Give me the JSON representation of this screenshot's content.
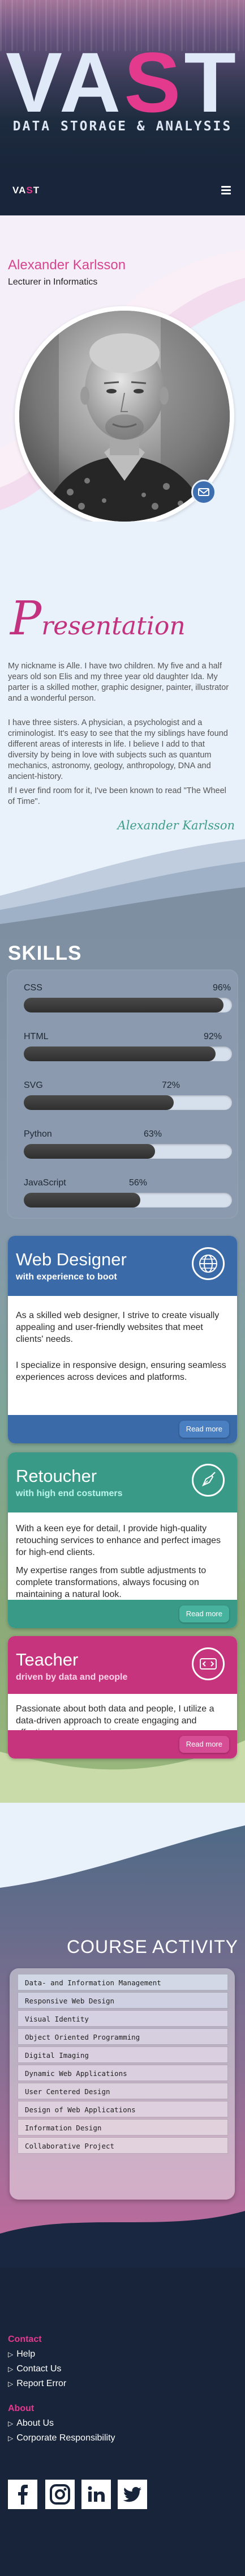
{
  "hero": {
    "brand": "VAST",
    "subtitle": "DATA STORAGE & ANALYSIS"
  },
  "navbar": {
    "logo": "VAST",
    "menu_icon": "hamburger-menu-icon"
  },
  "profile": {
    "name": "Alexander Karlsson",
    "role": "Lecturer in Informatics",
    "mail_icon": "envelope-icon"
  },
  "presentation": {
    "heading_initial": "P",
    "heading_rest": "resentation",
    "paragraphs": [
      "My nickname is Alle. I have two children. My five and a half years old son Elis and my three year old daughter Ida. My parter is a skilled mother, graphic designer, painter, illustrator and a wonderful person.",
      "I have three sisters. A physician, a psychologist and a criminologist. It's easy to see that the my siblings have found different areas of interests in life. I believe I add to that diversity by being in love with subjects such as quantum mechanics, astronomy, geology, anthropology, DNA and ancient-history.",
      "If I ever find room for it, I've been known to read \"The Wheel of Time\"."
    ],
    "signature": "Alexander Karlsson"
  },
  "skills": {
    "title": "SKILLS",
    "items": [
      {
        "label": "CSS",
        "pct_label": "96%",
        "level": 0.96
      },
      {
        "label": "HTML",
        "pct_label": "92%",
        "level": 0.92
      },
      {
        "label": "SVG",
        "pct_label": "72%",
        "level": 0.72
      },
      {
        "label": "Python",
        "pct_label": "63%",
        "level": 0.63
      },
      {
        "label": "JavaScript",
        "pct_label": "56%",
        "level": 0.56
      }
    ]
  },
  "cards": [
    {
      "title": "Web Designer",
      "subtitle": "with experience to boot",
      "icon": "globe-icon",
      "paragraphs": [
        "As a skilled web designer, I strive to create visually appealing and user-friendly websites that meet clients' needs.",
        "I specialize in responsive design, ensuring seamless experiences across devices and platforms."
      ],
      "button": "Read more",
      "head_color": "#3a6aa8",
      "sub_color": "#ffffff",
      "foot_color": "#3a6aa8",
      "btn_color": "#4a7fc2"
    },
    {
      "title": "Retoucher",
      "subtitle": "with high end costumers",
      "icon": "pen-nib-icon",
      "paragraphs": [
        "With a keen eye for detail, I provide high-quality retouching services to enhance and perfect images for high-end clients.",
        "My expertise ranges from subtle adjustments to complete transformations, always focusing on maintaining a natural look."
      ],
      "button": "Read more",
      "head_color": "#3a9a88",
      "sub_color": "#b9f5ea",
      "foot_color": "#3a9a88",
      "btn_color": "#47b39f"
    },
    {
      "title": "Teacher",
      "subtitle": "driven by data and people",
      "icon": "code-icon",
      "paragraphs": [
        "Passionate about both data and people, I utilize a data-driven approach to create engaging and effective learning experiences."
      ],
      "button": "Read more",
      "head_color": "#c5347c",
      "sub_color": "#ffd4ea",
      "foot_color": "#c5347c",
      "btn_color": "#d74d95"
    }
  ],
  "courses": {
    "title": "COURSE ACTIVITY",
    "items": [
      "Data- and Information Management",
      "Responsive Web Design",
      "Visual Identity",
      "Object Oriented Programming",
      "Digital Imaging",
      "Dynamic Web Applications",
      "User Centered Design",
      "Design of Web Applications",
      "Information Design",
      "Collaborative Project"
    ]
  },
  "footer": {
    "contact_heading": "Contact",
    "contact_links": [
      "Help",
      "Contact Us",
      "Report Error"
    ],
    "about_heading": "About",
    "about_links": [
      "About Us",
      "Corporate Responsibility"
    ],
    "social": [
      "facebook-icon",
      "instagram-icon",
      "linkedin-icon",
      "twitter-icon"
    ]
  }
}
